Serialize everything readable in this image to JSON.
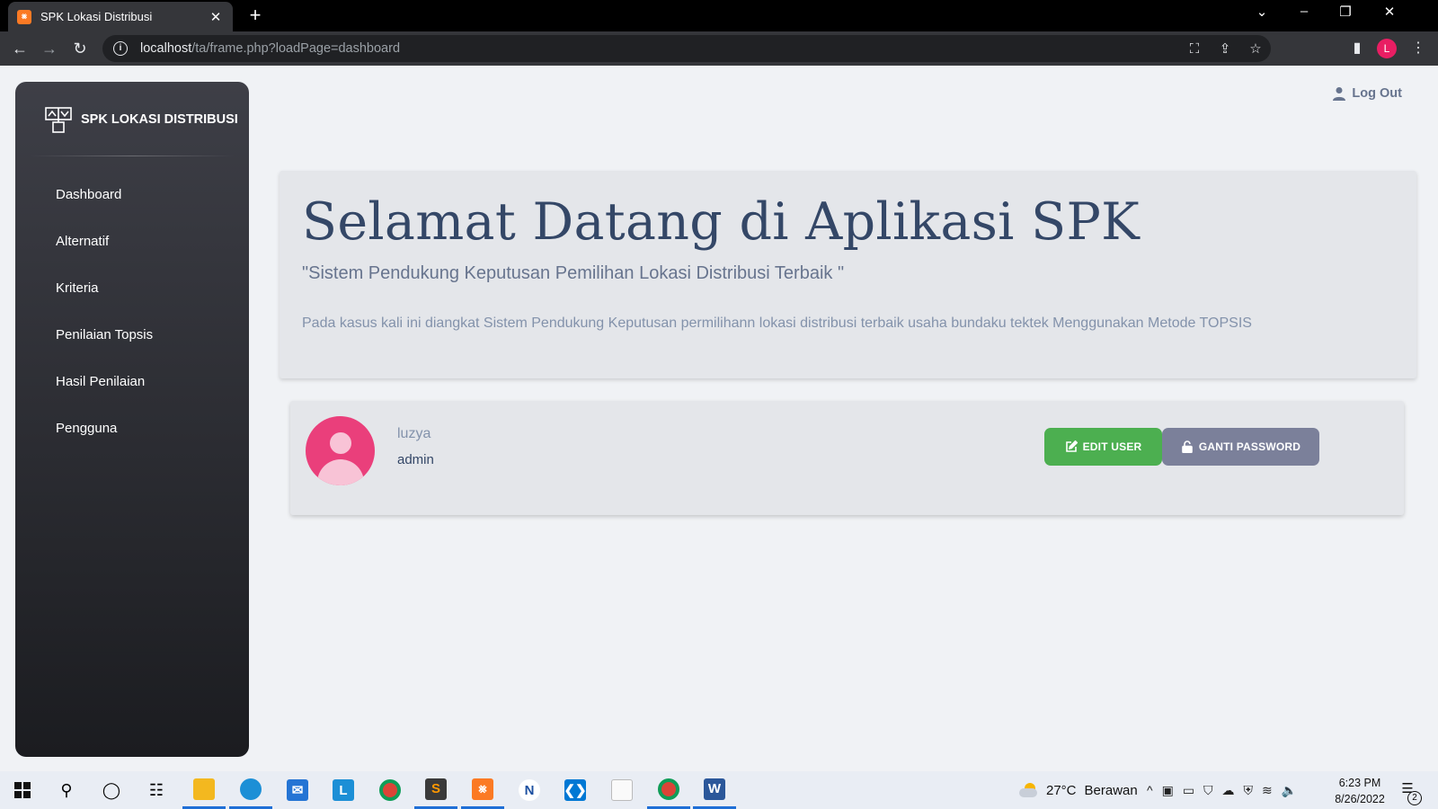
{
  "browser": {
    "tab_title": "SPK Lokasi Distribusi",
    "tab_close": "✕",
    "new_tab": "+",
    "url_host": "localhost",
    "url_path": "/ta/frame.php?loadPage=dashboard",
    "profile_initial": "L"
  },
  "sidebar": {
    "brand": "SPK LOKASI DISTRIBUSI",
    "items": [
      {
        "label": "Dashboard"
      },
      {
        "label": "Alternatif"
      },
      {
        "label": "Kriteria"
      },
      {
        "label": "Penilaian Topsis"
      },
      {
        "label": "Hasil Penilaian"
      },
      {
        "label": "Pengguna"
      }
    ]
  },
  "header": {
    "logout": "Log Out"
  },
  "jumbotron": {
    "title": "Selamat Datang di Aplikasi SPK",
    "subtitle": "\"Sistem Pendukung Keputusan Pemilihan Lokasi Distribusi Terbaik \"",
    "text": "Pada kasus kali ini diangkat Sistem Pendukung Keputusan permilihann lokasi distribusi terbaik usaha bundaku tektek Menggunakan Metode TOPSIS"
  },
  "user": {
    "name": "luzya",
    "role": "admin",
    "edit_label": "EDIT USER",
    "password_label": "GANTI PASSWORD"
  },
  "taskbar": {
    "weather_temp": "27°C",
    "weather_text": "Berawan",
    "time": "6:23 PM",
    "date": "8/26/2022",
    "notifications": "2"
  },
  "colors": {
    "primary_text": "#344767",
    "secondary_text": "#67748e",
    "edit_button": "#4caf50",
    "password_button": "#7b809a",
    "avatar": "#ea3f7b"
  }
}
